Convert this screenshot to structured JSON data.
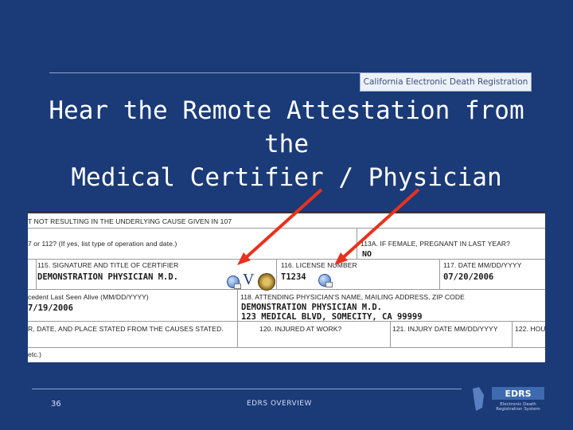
{
  "header": {
    "brand": "California Electronic Death Registration",
    "title_line1": "Hear the Remote Attestation from the",
    "title_line2": "Medical Certifier / Physician"
  },
  "form": {
    "row0": "T NOT RESULTING IN THE UNDERLYING CAUSE GIVEN IN 107",
    "row1_left": "7 or 112? (If yes, list type of operation and date.)",
    "f113a_label": "113A. IF FEMALE, PREGNANT IN LAST YEAR?",
    "f113a_value": "NO",
    "f115_label": "115. SIGNATURE AND TITLE OF CERTIFIER",
    "f115_value": "DEMONSTRATION PHYSICIAN M.D.",
    "f116_label": "116. LICENSE NUMBER",
    "f116_value": "T1234",
    "f117_label": "117. DATE MM/DD/YYYY",
    "f117_value": "07/20/2006",
    "last_seen_label": "cedent Last Seen Alive (MM/DD/YYYY)",
    "last_seen_value": "7/19/2006",
    "f118_label": "118. ATTENDING PHYSICIAN'S NAME, MAILING ADDRESS, ZIP CODE",
    "f118_line1": "DEMONSTRATION PHYSICIAN M.D.",
    "f118_line2": "123 MEDICAL BLVD, SOMECITY, CA 99999",
    "row4_left": "R, DATE, AND PLACE STATED FROM THE CAUSES STATED.",
    "f120_label": "120. INJURED AT WORK?",
    "f121_label": "121. INJURY DATE MM/DD/YYYY",
    "f122_label": "122. HOU",
    "row5_left": "etc.)"
  },
  "footer": {
    "page_number": "36",
    "text": "EDRS OVERVIEW",
    "logo_text": "EDRS",
    "logo_sub1": "Electronic Death",
    "logo_sub2": "Registration System"
  },
  "colors": {
    "background": "#1a3a78",
    "arrow": "#e8321e"
  }
}
